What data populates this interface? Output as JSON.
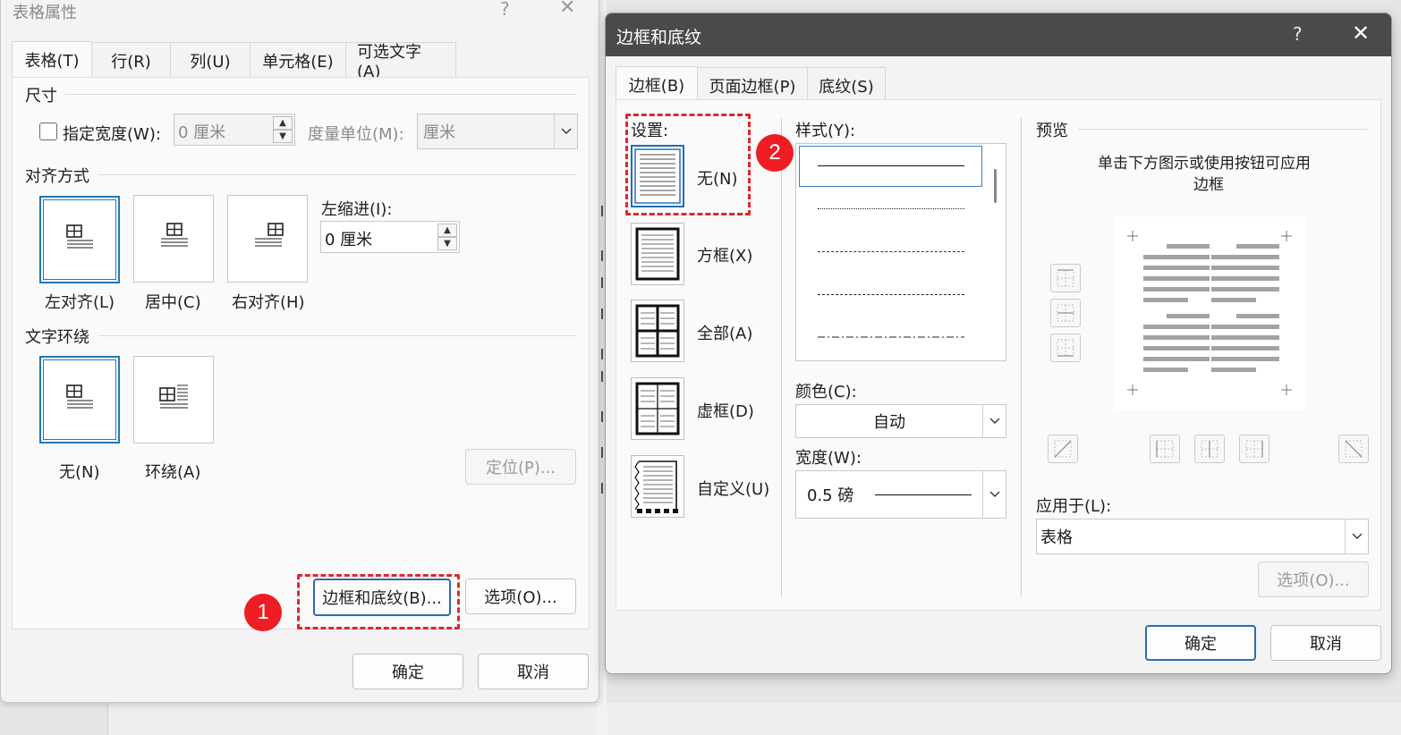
{
  "table_props": {
    "title": "表格属性",
    "help": "?",
    "close": "✕",
    "tabs": [
      "表格(T)",
      "行(R)",
      "列(U)",
      "单元格(E)",
      "可选文字(A)"
    ],
    "size_section": "尺寸",
    "preferred_width_label": "指定宽度(W):",
    "preferred_width_value": "0 厘米",
    "measure_in_label": "度量单位(M):",
    "measure_in_value": "厘米",
    "alignment_section": "对齐方式",
    "align_options": [
      "左对齐(L)",
      "居中(C)",
      "右对齐(H)"
    ],
    "indent_label": "左缩进(I):",
    "indent_value": "0 厘米",
    "wrap_section": "文字环绕",
    "wrap_options": [
      "无(N)",
      "环绕(A)"
    ],
    "positioning_button": "定位(P)...",
    "borders_button": "边框和底纹(B)...",
    "options_button": "选项(O)...",
    "ok": "确定",
    "cancel": "取消"
  },
  "borders_dialog": {
    "title": "边框和底纹",
    "help": "?",
    "close": "✕",
    "tabs": [
      "边框(B)",
      "页面边框(P)",
      "底纹(S)"
    ],
    "setting_label": "设置:",
    "settings": [
      "无(N)",
      "方框(X)",
      "全部(A)",
      "虚框(D)",
      "自定义(U)"
    ],
    "style_label": "样式(Y):",
    "color_label": "颜色(C):",
    "color_value": "自动",
    "width_label": "宽度(W):",
    "width_value": "0.5 磅",
    "preview_label": "预览",
    "preview_hint_1": "单击下方图示或使用按钮可应用",
    "preview_hint_2": "边框",
    "apply_to_label": "应用于(L):",
    "apply_to_value": "表格",
    "options_button": "选项(O)...",
    "ok": "确定",
    "cancel": "取消"
  },
  "annotations": {
    "badge_1": "1",
    "badge_2": "2",
    "color": "#e0262c"
  }
}
